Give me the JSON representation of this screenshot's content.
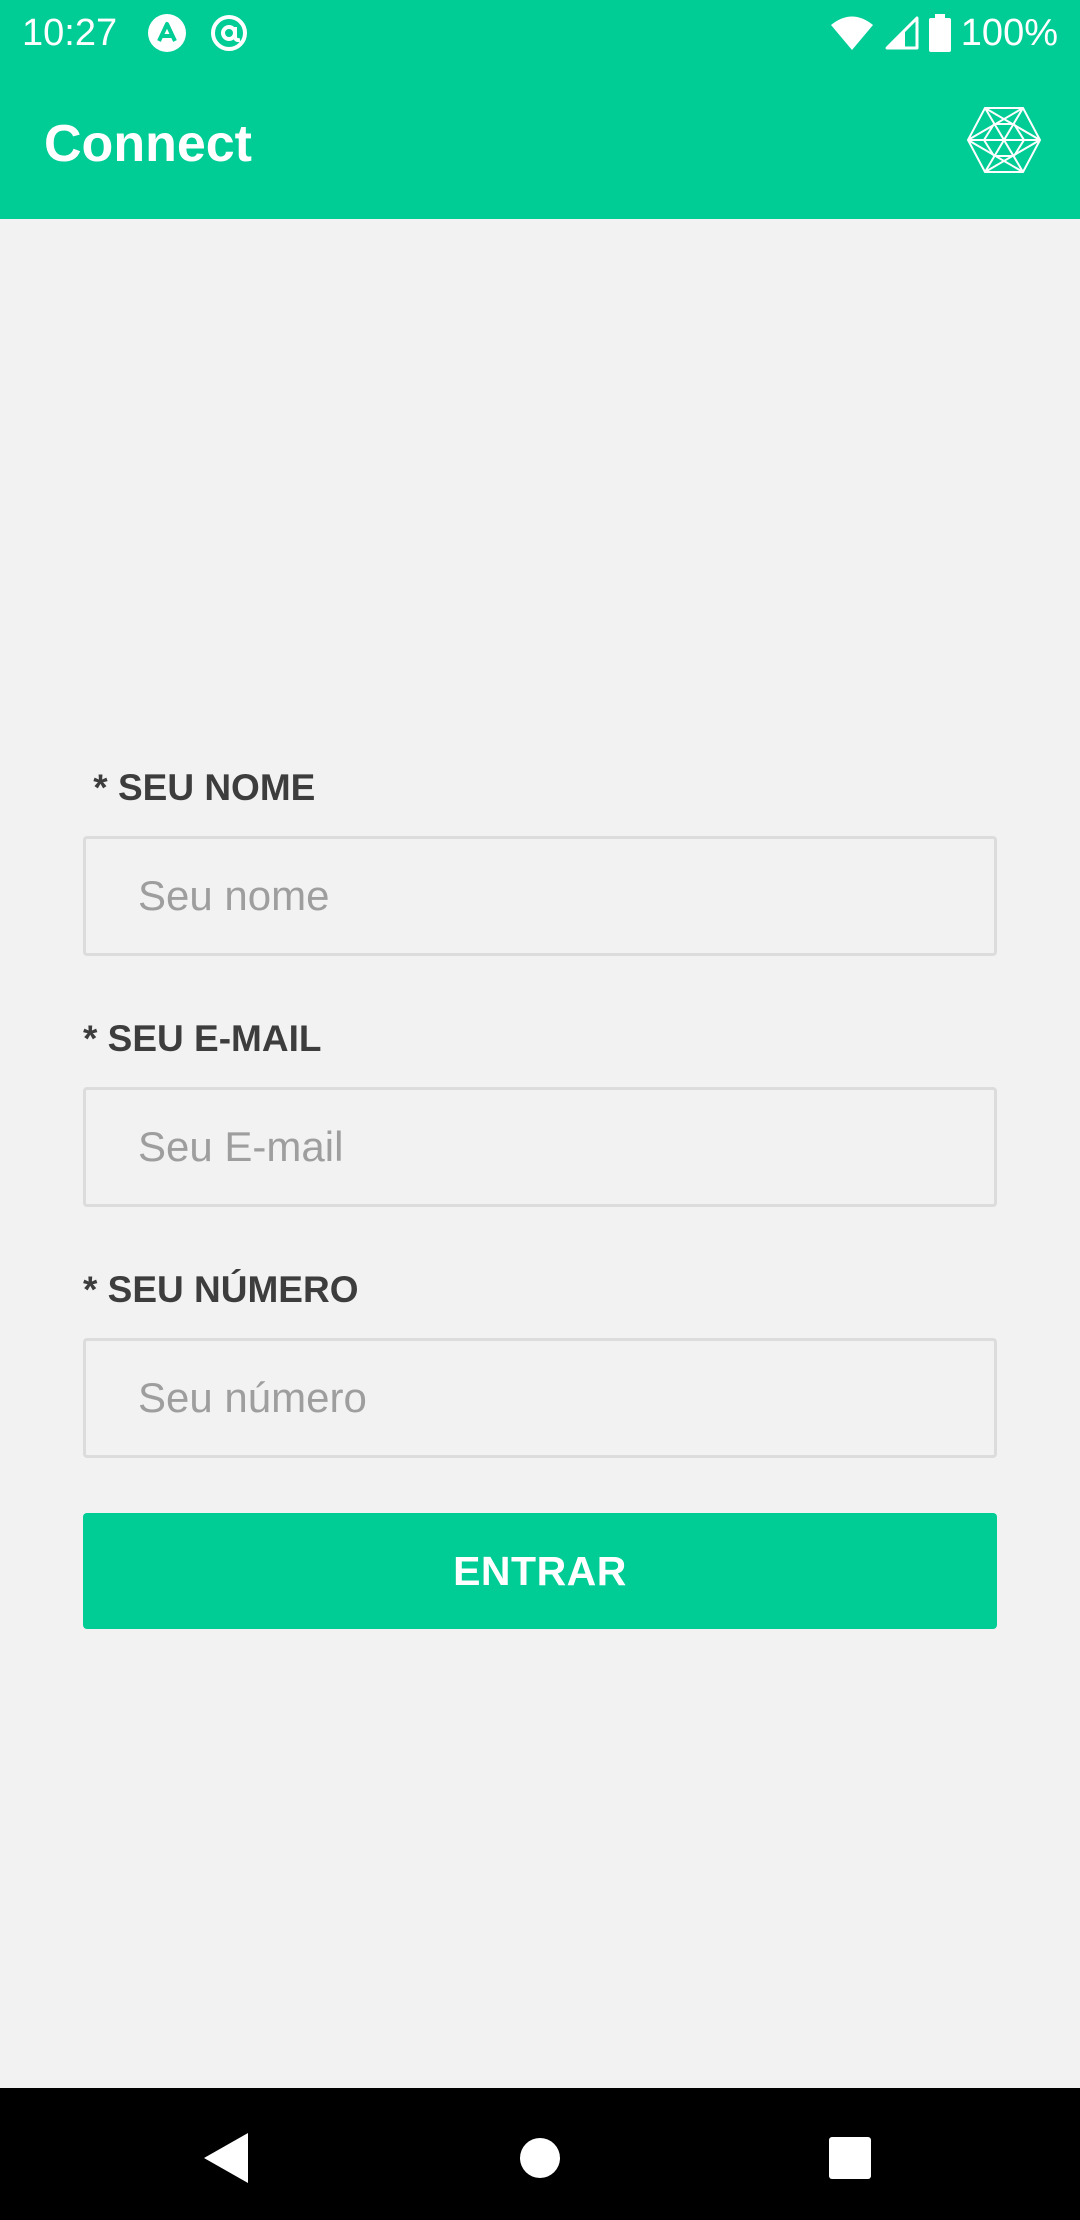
{
  "status_bar": {
    "time": "10:27",
    "battery": "100%",
    "icons": [
      "notification-a-icon",
      "notification-at-icon",
      "wifi-icon",
      "signal-icon",
      "battery-icon"
    ]
  },
  "app_bar": {
    "title": "Connect",
    "logo_icon": "hexagon-mesh-logo-icon"
  },
  "form": {
    "fields": [
      {
        "label": " * SEU NOME",
        "placeholder": "Seu nome",
        "value": ""
      },
      {
        "label": "* SEU E-MAIL",
        "placeholder": "Seu E-mail",
        "value": ""
      },
      {
        "label": "* SEU NÚMERO",
        "placeholder": "Seu número",
        "value": ""
      }
    ],
    "submit_label": "ENTRAR"
  },
  "nav_bar": {
    "icons": [
      "back-icon",
      "home-icon",
      "recents-icon"
    ]
  },
  "colors": {
    "accent": "#00cc96",
    "background": "#f2f2f2",
    "label_text": "#3d3d3d",
    "placeholder_text": "#9e9e9e",
    "nav_background": "#000000"
  }
}
